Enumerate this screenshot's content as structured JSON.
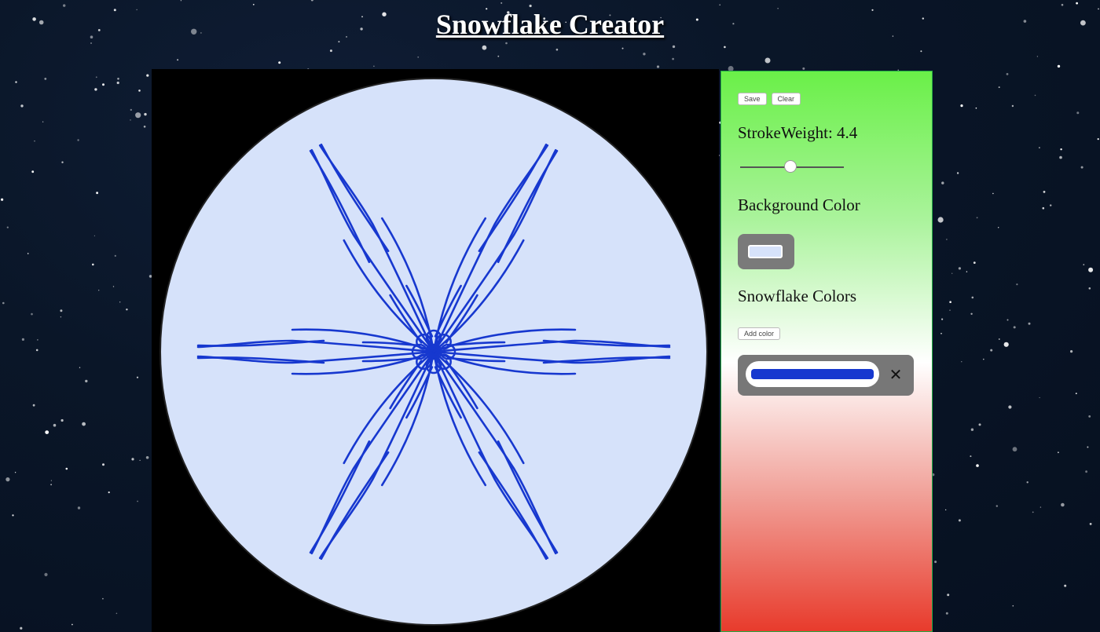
{
  "app": {
    "title": "Snowflake Creator"
  },
  "toolbar": {
    "save_label": "Save",
    "clear_label": "Clear"
  },
  "controls": {
    "stroke_weight_text": "StrokeWeight: 4.4",
    "stroke_weight_value": 4.4,
    "background_color_label": "Background Color",
    "background_color": "#d6e2fa",
    "snowflake_colors_label": "Snowflake Colors",
    "add_color_label": "Add color",
    "snowflake_colors": [
      "#1738cf"
    ],
    "remove_color_glyph": "✕"
  },
  "canvas": {
    "background": "#000000",
    "disc_color": "#d6e2fa",
    "stroke_color": "#1738cf",
    "symmetry": 6
  },
  "colors": {
    "panel_top": "#6af048",
    "panel_middle": "#ffffff",
    "panel_bottom": "#e83b2c",
    "sky": "#0a1628"
  }
}
